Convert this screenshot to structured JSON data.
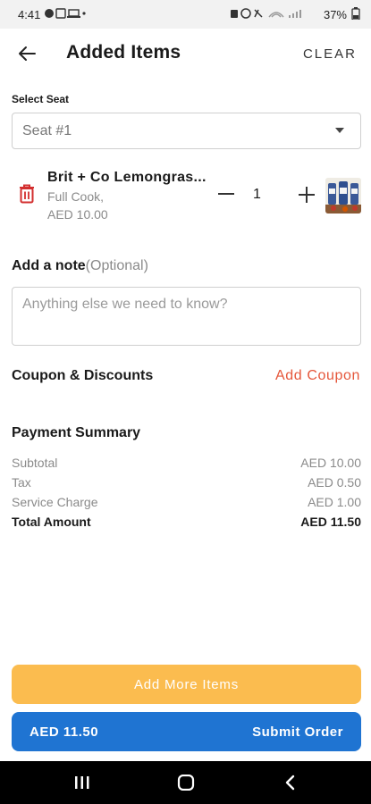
{
  "status_bar": {
    "time": "4:41",
    "battery": "37%"
  },
  "header": {
    "title": "Added Items",
    "clear_label": "CLEAR"
  },
  "seat": {
    "label": "Select Seat",
    "selected": "Seat #1"
  },
  "cart_item": {
    "name": "Brit + Co Lemongras...",
    "description": "Full Cook,",
    "price": "AED 10.00",
    "quantity": "1"
  },
  "note": {
    "label": "Add a note",
    "optional": "(Optional)",
    "placeholder": "Anything else we need to know?"
  },
  "coupon": {
    "label": "Coupon & Discounts",
    "link": "Add Coupon"
  },
  "payment": {
    "title": "Payment Summary",
    "rows": [
      {
        "label": "Subtotal",
        "value": "AED 10.00"
      },
      {
        "label": "Tax",
        "value": "AED 0.50"
      },
      {
        "label": "Service Charge",
        "value": "AED 1.00"
      },
      {
        "label": "Total Amount",
        "value": "AED 11.50"
      }
    ]
  },
  "actions": {
    "add_more": "Add More Items",
    "submit_amount": "AED 11.50",
    "submit_label": "Submit Order"
  },
  "colors": {
    "accent_orange": "#fbbc4f",
    "primary_blue": "#1f74d2",
    "coupon_red": "#e5563a",
    "trash_red": "#d32f2f"
  }
}
